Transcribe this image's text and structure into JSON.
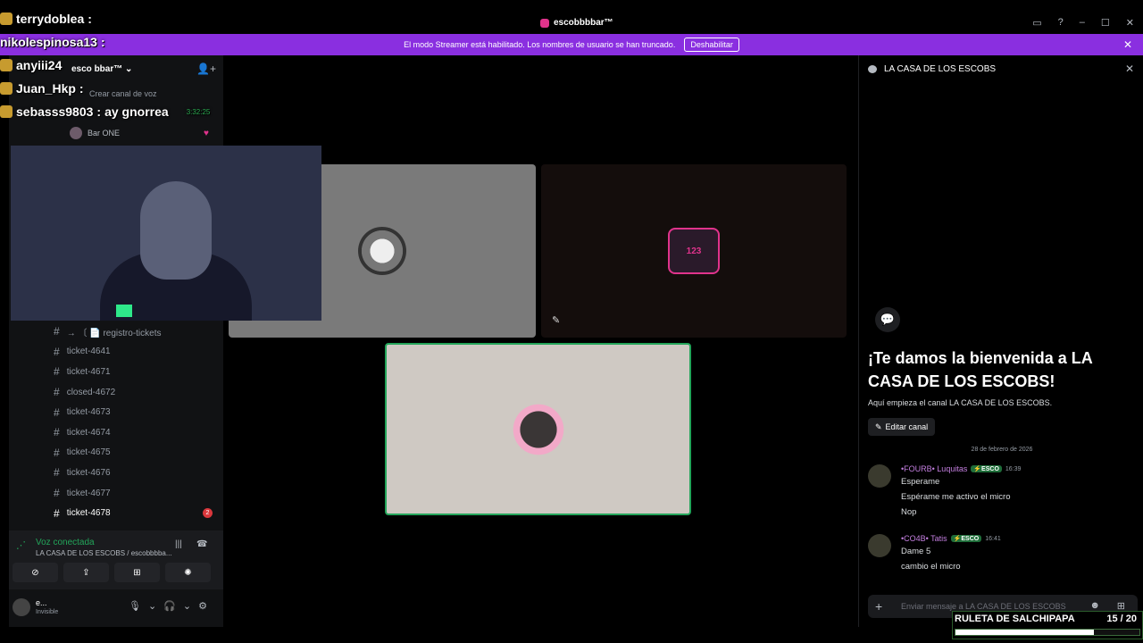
{
  "window": {
    "title": "escobbbbar™",
    "controls": [
      "▭",
      "?",
      "–",
      "☐",
      "✕"
    ]
  },
  "streamer_bar": {
    "message": "El modo Streamer está habilitado. Los nombres de usuario se han truncado.",
    "button": "Deshabilitar"
  },
  "sidebar": {
    "server_name": "esco   bbar™ ⌄",
    "create_voice": "Crear canal de voz",
    "bar_one": "Bar ONE",
    "channels": [
      {
        "label": "→ 〔 📄 registro-tickets",
        "active": false
      },
      {
        "label": "ticket-4641",
        "active": false
      },
      {
        "label": "ticket-4671",
        "active": false
      },
      {
        "label": "closed-4672",
        "active": false
      },
      {
        "label": "ticket-4673",
        "active": false
      },
      {
        "label": "ticket-4674",
        "active": false
      },
      {
        "label": "ticket-4675",
        "active": false
      },
      {
        "label": "ticket-4676",
        "active": false
      },
      {
        "label": "ticket-4677",
        "active": false
      },
      {
        "label": "ticket-4678",
        "active": true,
        "badge": "2"
      }
    ],
    "voice": {
      "status": "Voz conectada",
      "channel": "LA CASA DE LOS ESCOBS / escobbbba..."
    },
    "user": {
      "name": "e...",
      "status": "Invisible"
    }
  },
  "chat_overlay": [
    {
      "name": "terrydoblea",
      "text": ""
    },
    {
      "name": "nikolespinosa13",
      "text": ""
    },
    {
      "name": "anyiii24",
      "text": ""
    },
    {
      "name": "Juan_Hkp",
      "text": ""
    },
    {
      "name": "sebasss9803",
      "text": "ay gnorrea",
      "time": "3:32:25"
    }
  ],
  "right_panel": {
    "channel_name": "LA CASA DE LOS ESCOBS",
    "welcome_title": "¡Te damos la bienvenida a LA CASA DE LOS ESCOBS!",
    "welcome_sub": "Aquí empieza el canal LA CASA DE LOS ESCOBS.",
    "edit_button": "Editar canal",
    "date_divider": "28 de febrero de 2026",
    "messages": [
      {
        "author": "•FOURB• Luquitas",
        "tag": "⚡ESCO",
        "time": "16:39",
        "lines": [
          "Esperame",
          "Espérame me activo el micro",
          "Nop"
        ]
      },
      {
        "author": "•CO4B• Tatis",
        "tag": "⚡ESCO",
        "time": "16:41",
        "lines": [
          "Dame 5",
          "cambio el micro"
        ]
      }
    ],
    "input_placeholder": "Enviar mensaje a LA CASA DE LOS ESCOBS"
  },
  "ruleta": {
    "label": "RULETA DE SALCHIPAPA",
    "count": "15  / 20",
    "progress": 0.75
  },
  "colors": {
    "accent": "#8a2fe0",
    "green": "#23a55a",
    "pink": "#e0338c"
  }
}
